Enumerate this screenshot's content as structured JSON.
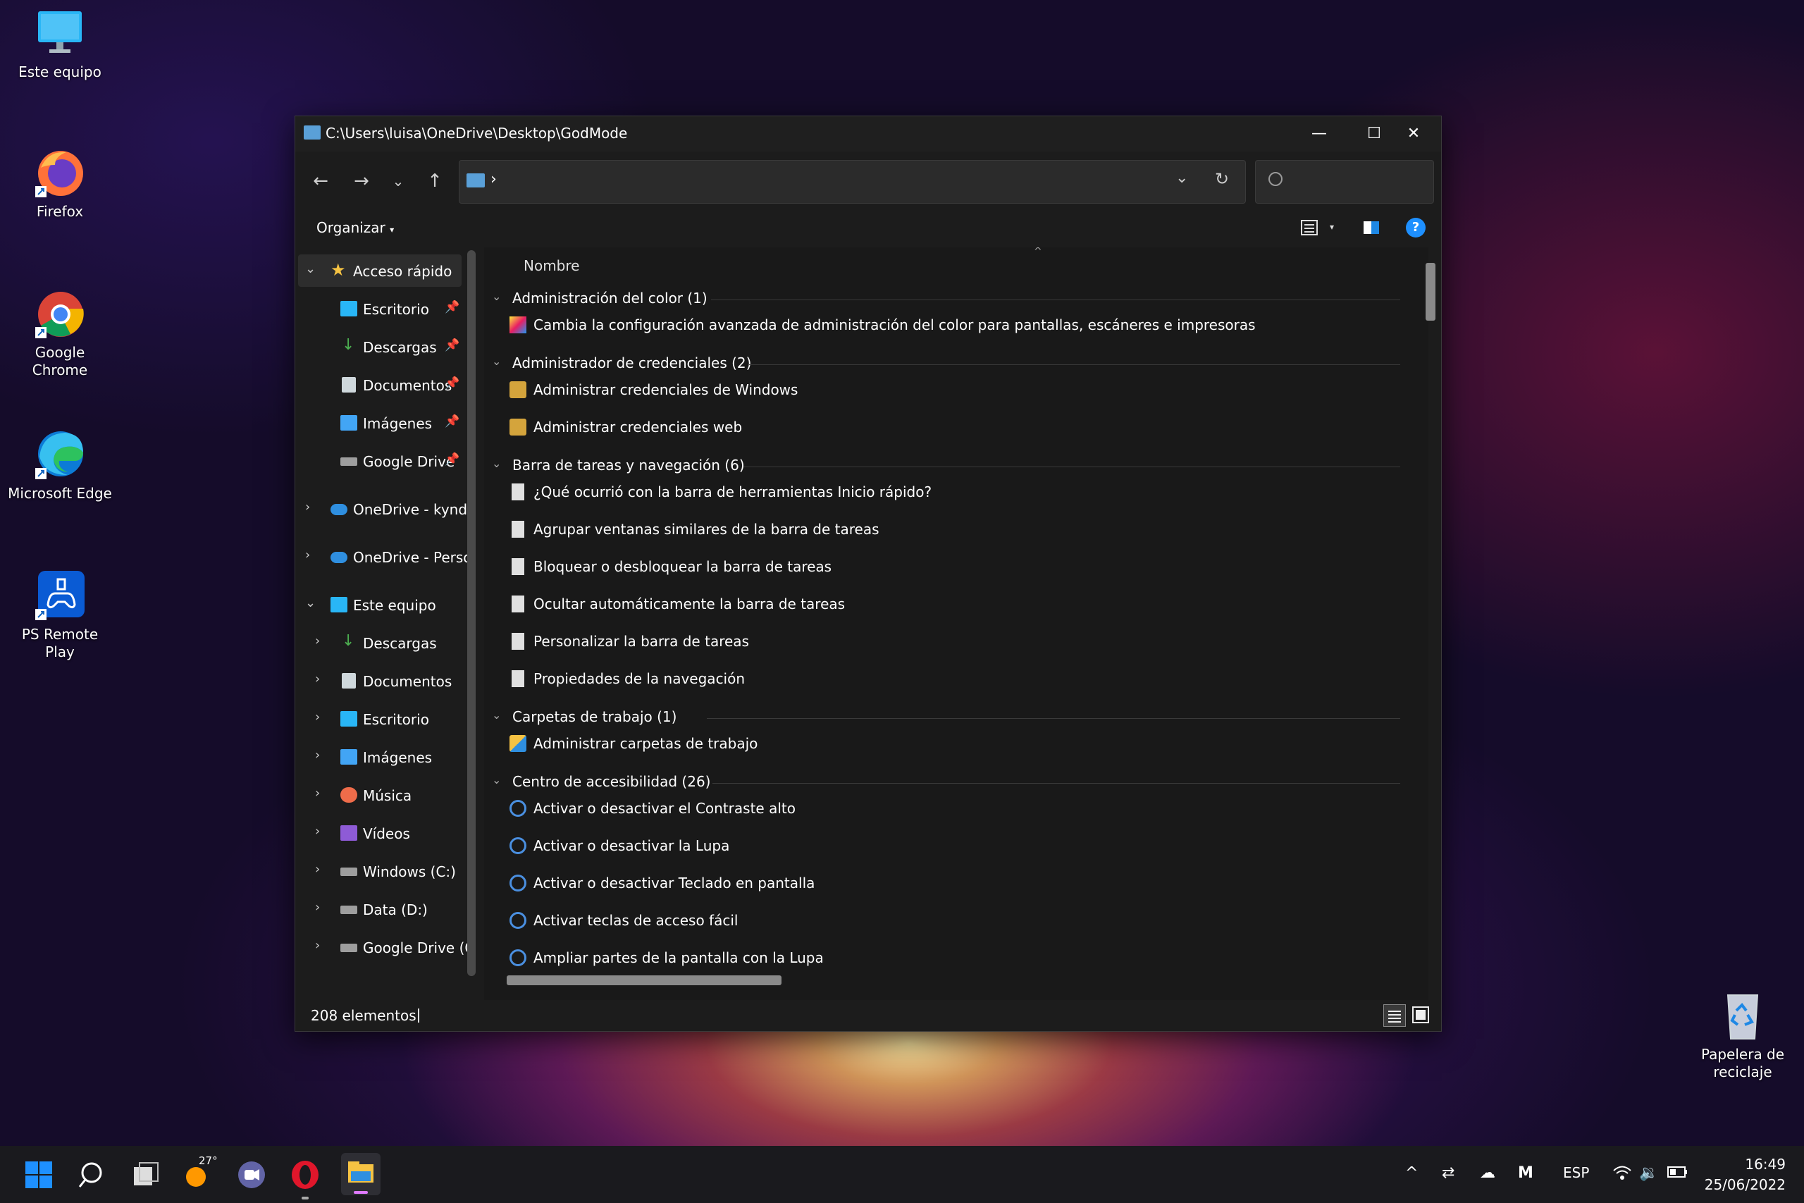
{
  "desktop": {
    "icons": [
      {
        "label": "Este equipo",
        "icon": "monitor-icon"
      },
      {
        "label": "Firefox",
        "icon": "firefox-icon"
      },
      {
        "label": "Google Chrome",
        "icon": "chrome-icon"
      },
      {
        "label": "Microsoft Edge",
        "icon": "edge-icon"
      },
      {
        "label": "PS Remote Play",
        "icon": "ps-remote-play-icon"
      }
    ],
    "recycle_bin": {
      "line1": "Papelera de",
      "line2": "reciclaje"
    }
  },
  "window": {
    "title": "C:\\Users\\luisa\\OneDrive\\Desktop\\GodMode",
    "address_separator": "›",
    "search_placeholder": "",
    "organize_label": "Organizar",
    "column_header": "Nombre",
    "status": "208 elementos"
  },
  "nav_pane": {
    "quick_access": {
      "label": "Acceso rápido",
      "items": [
        "Escritorio",
        "Descargas",
        "Documentos",
        "Imágenes",
        "Google Drive"
      ]
    },
    "onedrive1": "OneDrive - kyndı",
    "onedrive2": "OneDrive - Perso",
    "this_pc": {
      "label": "Este equipo",
      "items": [
        "Descargas",
        "Documentos",
        "Escritorio",
        "Imágenes",
        "Música",
        "Vídeos",
        "Windows (C:)",
        "Data (D:)",
        "Google Drive (G"
      ]
    }
  },
  "groups": [
    {
      "label": "Administración del color (1)",
      "items": [
        "Cambia la configuración avanzada de administración del color para pantallas, escáneres e impresoras"
      ]
    },
    {
      "label": "Administrador de credenciales (2)",
      "items": [
        "Administrar credenciales de Windows",
        "Administrar credenciales web"
      ]
    },
    {
      "label": "Barra de tareas y navegación (6)",
      "items": [
        "¿Qué ocurrió con la barra de herramientas Inicio rápido?",
        "Agrupar ventanas similares de la barra de tareas",
        "Bloquear o desbloquear la barra de tareas",
        "Ocultar automáticamente la barra de tareas",
        "Personalizar la barra de tareas",
        "Propiedades de la navegación"
      ]
    },
    {
      "label": "Carpetas de trabajo (1)",
      "items": [
        "Administrar carpetas de trabajo"
      ]
    },
    {
      "label": "Centro de accesibilidad (26)",
      "items": [
        "Activar o desactivar el Contraste alto",
        "Activar o desactivar la Lupa",
        "Activar o desactivar Teclado en pantalla",
        "Activar teclas de acceso fácil",
        "Ampliar partes de la pantalla con la Lupa"
      ]
    }
  ],
  "taskbar": {
    "weather_temp": "27°",
    "language": "ESP",
    "time": "16:49",
    "date": "25/06/2022"
  },
  "colors": {
    "accent": "#0a84ff",
    "window_bg": "#1c1c1c",
    "help_blue": "#1e90ff"
  }
}
